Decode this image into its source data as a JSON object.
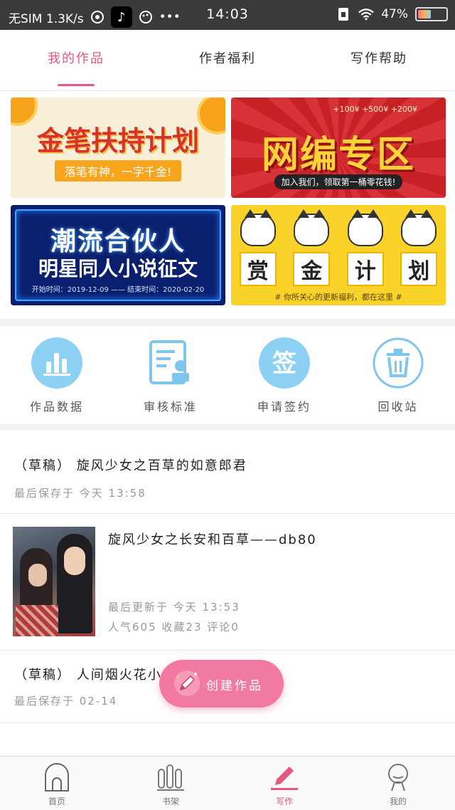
{
  "status_bar": {
    "carrier": "无SIM 1.3K/s",
    "time": "14:03",
    "battery": "47%",
    "battery_level": 0.47,
    "more": "•••"
  },
  "tabs": [
    {
      "label": "我的作品",
      "active": true
    },
    {
      "label": "作者福利",
      "active": false
    },
    {
      "label": "写作帮助",
      "active": false
    }
  ],
  "banners": {
    "b1": {
      "title": "金笔扶持计划",
      "subtitle": "落笔有神，一字千金!"
    },
    "b2": {
      "title": "网编专区",
      "subtitle": "加入我们，领取第一桶零花钱!",
      "coins": "+100¥  +500¥  +200¥"
    },
    "b3": {
      "title": "潮流合伙人",
      "title2": "明星同人小说征文",
      "subtitle": "开始时间：2019-12-09 —— 结束时间：2020-02-20"
    },
    "b4": {
      "chars": [
        "赏",
        "金",
        "计",
        "划"
      ],
      "subtitle": "# 你所关心的更新福利，都在这里 #"
    }
  },
  "actions": [
    {
      "label": "作品数据",
      "icon": "bar-chart-icon"
    },
    {
      "label": "审核标准",
      "icon": "document-stamp-icon"
    },
    {
      "label": "申请签约",
      "icon": "sign-icon"
    },
    {
      "label": "回收站",
      "icon": "trash-icon"
    }
  ],
  "sign_glyph": "签",
  "works": [
    {
      "title": "（草稿） 旋风少女之百草的如意郎君",
      "meta": "最后保存于 今天 13:58"
    },
    {
      "title": "旋风少女之长安和百草——db80",
      "updated": "最后更新于 今天 13:53",
      "stats": "人气605 收藏23 评论0"
    },
    {
      "title": "（草稿） 人间烟火花小",
      "meta": "最后保存于 02-14"
    }
  ],
  "fab": {
    "label": "创建作品"
  },
  "bottom_nav": [
    {
      "label": "首页",
      "icon": "home-icon"
    },
    {
      "label": "书架",
      "icon": "bookshelf-icon"
    },
    {
      "label": "写作",
      "icon": "pen-icon",
      "active": true
    },
    {
      "label": "我的",
      "icon": "profile-icon"
    }
  ],
  "colors": {
    "accent": "#e8577d",
    "fab": "#f27aa0",
    "action_blue": "#7fc6ef"
  }
}
